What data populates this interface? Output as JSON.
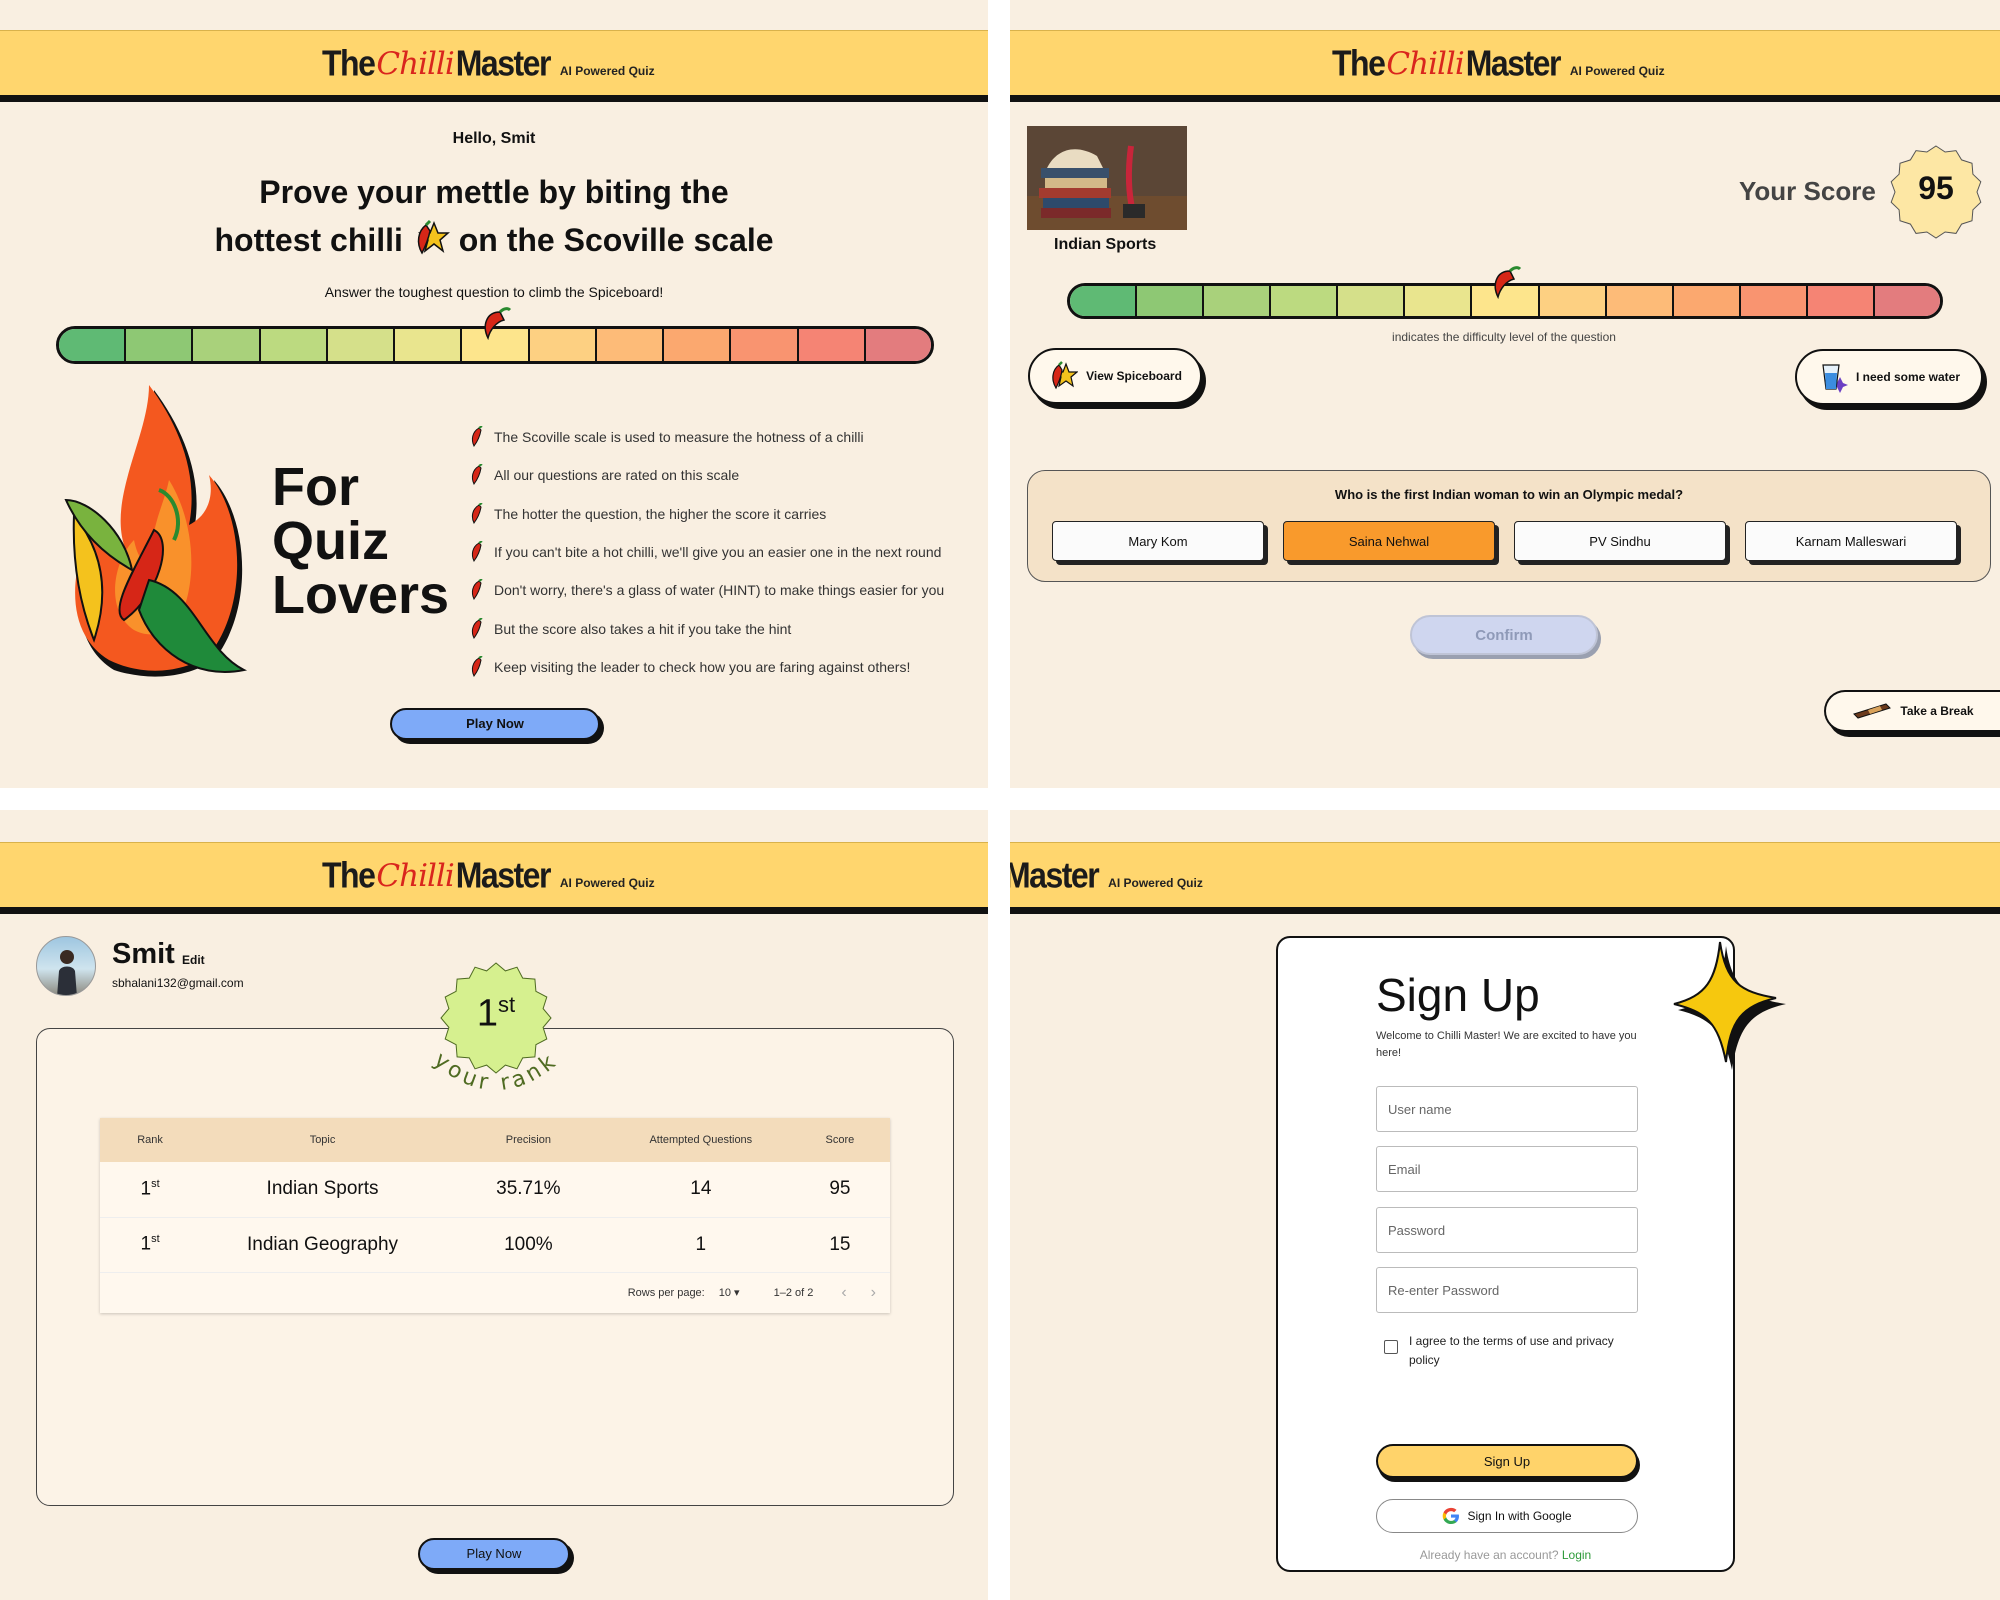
{
  "brand": {
    "the": "The",
    "chilli": "Chilli",
    "master": "Master",
    "subtitle": "AI Powered Quiz",
    "cropped_master": "Master"
  },
  "colors": {
    "header_bg": "#ffd66e",
    "panel_bg": "#f9efe1",
    "play_button": "#7eaaf8",
    "selected_option": "#f99a2c",
    "signup_button": "#ffd36a",
    "scale": [
      "#5fba74",
      "#8ec874",
      "#a9d17b",
      "#bcda80",
      "#d5e08a",
      "#e9e58e",
      "#fde58c",
      "#fdd082",
      "#fdbb78",
      "#fba86f",
      "#f99470",
      "#f58474",
      "#e37c7e"
    ]
  },
  "home": {
    "greeting": "Hello, Smit",
    "headline_line1": "Prove your mettle by biting the",
    "headline_line2a": "hottest chilli",
    "headline_line2b": "on the Scoville scale",
    "subtitle": "Answer the toughest question to climb the Spiceboard!",
    "scale_level": 7,
    "hero_line1": "For",
    "hero_line2": "Quiz",
    "hero_line3": "Lovers",
    "rules": [
      "The Scoville scale is used to measure the hotness of a chilli",
      "All our questions are rated on this scale",
      "The hotter the question, the higher the score it carries",
      "If you can't bite a hot chilli, we'll give you an easier one in the next round",
      "Don't worry, there's a glass of water (HINT) to make things easier for you",
      "But the score also takes a hit if you take the hint",
      "Keep visiting the leader to check how you are faring against others!"
    ],
    "play_button": "Play Now"
  },
  "quiz": {
    "topic": "Indian Sports",
    "score_label": "Your Score",
    "score": "95",
    "scale_level": 7,
    "scale_caption": "indicates the difficulty level of the question",
    "view_spiceboard": "View Spiceboard",
    "need_water": "I need some water",
    "question": "Who is the first Indian woman to win an Olympic medal?",
    "options": [
      "Mary Kom",
      "Saina Nehwal",
      "PV Sindhu",
      "Karnam Malleswari"
    ],
    "selected_option": "Saina Nehwal",
    "confirm": "Confirm",
    "take_break": "Take a Break"
  },
  "profile": {
    "name": "Smit",
    "edit": "Edit",
    "email": "sbhalani132@gmail.com",
    "rank_number": "1",
    "rank_suffix": "st",
    "rank_caption": "your rank",
    "columns": [
      "Rank",
      "Topic",
      "Precision",
      "Attempted Questions",
      "Score"
    ],
    "rows": [
      {
        "rank": "1",
        "rank_suffix": "st",
        "topic": "Indian Sports",
        "precision": "35.71%",
        "attempted": "14",
        "score": "95"
      },
      {
        "rank": "1",
        "rank_suffix": "st",
        "topic": "Indian Geography",
        "precision": "100%",
        "attempted": "1",
        "score": "15"
      }
    ],
    "rows_per_page_label": "Rows per page:",
    "rows_per_page_value": "10",
    "pagination": "1–2 of 2",
    "play_button": "Play Now"
  },
  "signup": {
    "title": "Sign Up",
    "welcome": "Welcome to Chilli Master! We are excited to have you here!",
    "username_placeholder": "User name",
    "email_placeholder": "Email",
    "password_placeholder": "Password",
    "reenter_placeholder": "Re-enter Password",
    "agree": "I agree to the terms of use and privacy policy",
    "signup_button": "Sign Up",
    "google_button": "Sign In with Google",
    "have_account": "Already have an account?",
    "login_link": "Login"
  }
}
